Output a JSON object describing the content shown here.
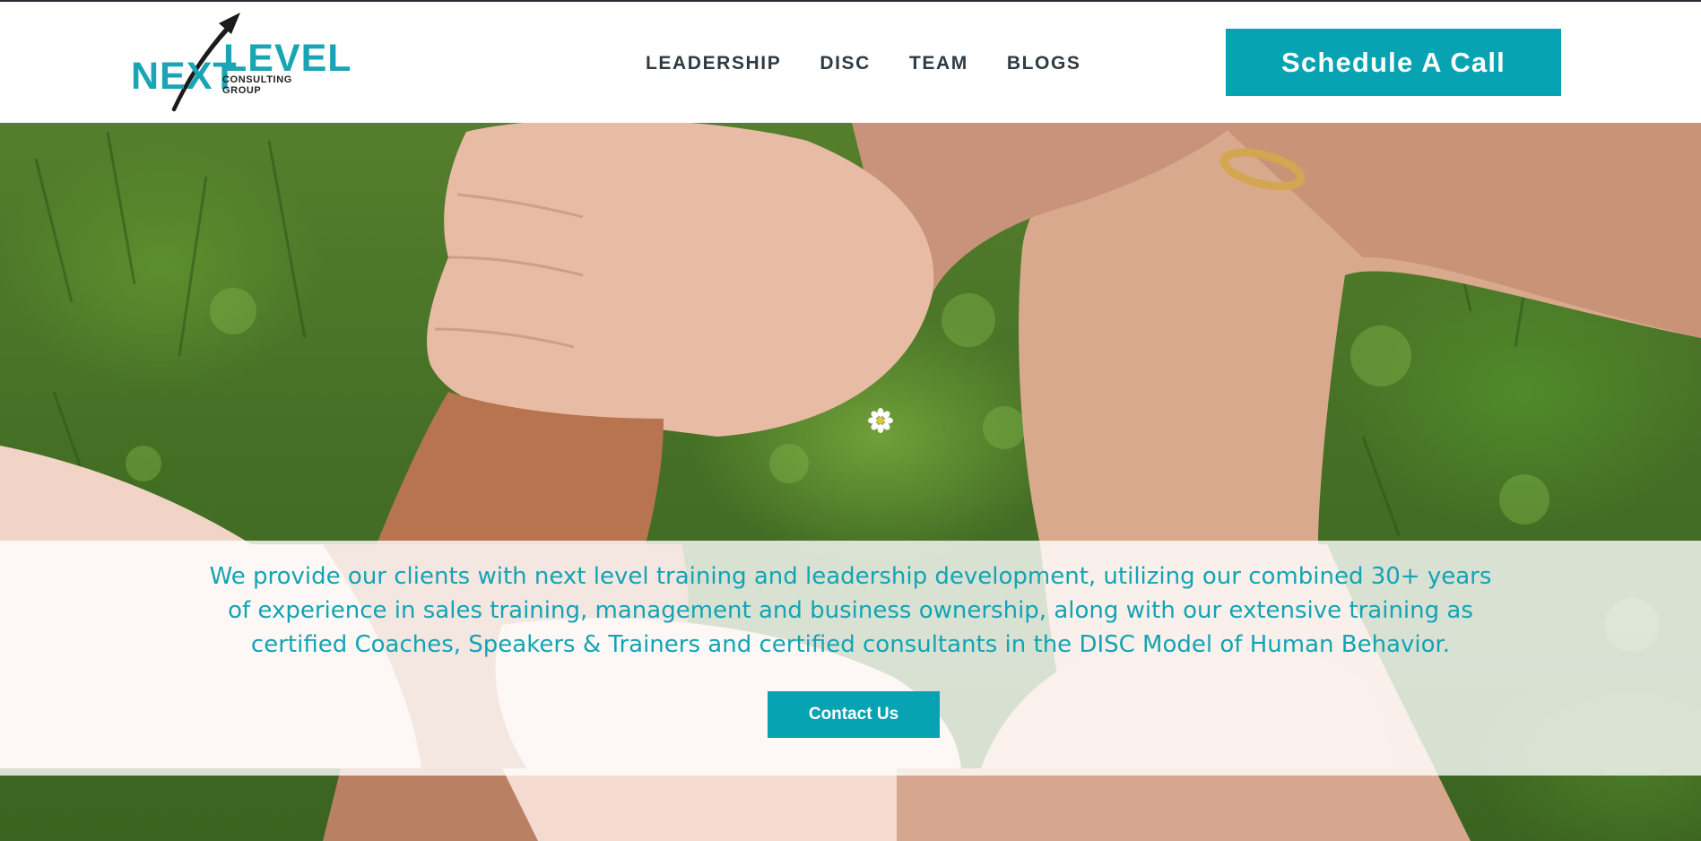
{
  "brand": {
    "logo_word_1": "NEXT",
    "logo_word_2": "LEVEL",
    "logo_sub_line_1": "CONSULTING",
    "logo_sub_line_2": "GROUP",
    "accent_color": "#08a3b2",
    "logo_icon": "arrow-icon"
  },
  "nav": {
    "items": [
      {
        "label": "LEADERSHIP"
      },
      {
        "label": "DISC"
      },
      {
        "label": "TEAM"
      },
      {
        "label": "BLOGS"
      }
    ]
  },
  "header": {
    "cta_label": "Schedule A Call"
  },
  "hero": {
    "image": "hands-interlocked-circle-on-grass",
    "description_line_1": "We provide our clients with next level training and leadership development, utilizing our combined 30+ years",
    "description_line_2": "of experience in sales training, management and business ownership, along with our extensive training as",
    "description_line_3": "certified Coaches, Speakers & Trainers and certified consultants in the DISC Model of Human Behavior.",
    "contact_label": "Contact Us"
  }
}
